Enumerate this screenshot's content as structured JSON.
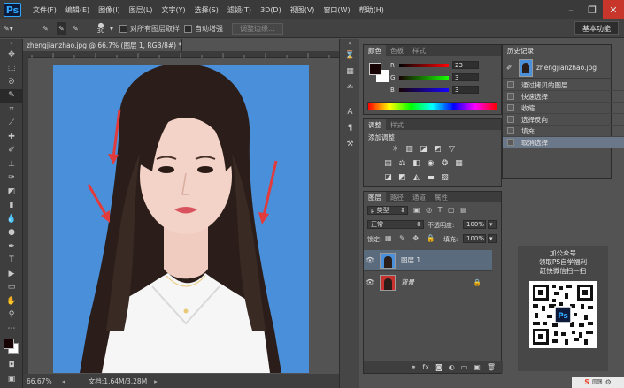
{
  "app": {
    "logo": "Ps"
  },
  "menu": [
    "文件(F)",
    "编辑(E)",
    "图像(I)",
    "图层(L)",
    "文字(Y)",
    "选择(S)",
    "滤镜(T)",
    "3D(D)",
    "视图(V)",
    "窗口(W)",
    "帮助(H)"
  ],
  "options": {
    "brush_size": "30",
    "sample_all_layers": "对所有图层取样",
    "auto_enhance": "自动增强",
    "refine_edge": "调整边缘...",
    "workspace": "基本功能"
  },
  "document": {
    "tab_title": "zhengjianzhao.jpg @ 66.7% (图层 1, RGB/8#) *",
    "zoom": "66.67%",
    "doc_size": "文档:1.64M/3.28M",
    "background_color": "#4a8fda"
  },
  "color_panel": {
    "tabs": [
      "颜色",
      "色板",
      "样式"
    ],
    "r_label": "R",
    "r_value": "23",
    "g_label": "G",
    "g_value": "3",
    "b_label": "B",
    "b_value": "3"
  },
  "adjust_panel": {
    "tabs": [
      "调整",
      "样式"
    ],
    "title": "添加调整"
  },
  "history_panel": {
    "title": "历史记录",
    "snapshot": "zhengjianzhao.jpg",
    "items": [
      "通过拷贝的图层",
      "快速选择",
      "收缩",
      "选择反向",
      "填充",
      "取消选择"
    ]
  },
  "layers_panel": {
    "tabs": [
      "图层",
      "路径",
      "通道",
      "属性"
    ],
    "filter_label": "ρ 类型",
    "blend_mode": "正常",
    "opacity_label": "不透明度:",
    "opacity_value": "100%",
    "lock_label": "锁定:",
    "fill_label": "填充:",
    "fill_value": "100%",
    "layers": [
      {
        "name": "图层 1"
      },
      {
        "name": "背景"
      }
    ]
  },
  "promo": {
    "line1": "加公众号",
    "line2": "领取PS自学福利",
    "line3": "赶快微信扫一扫",
    "badge": "Ps"
  }
}
